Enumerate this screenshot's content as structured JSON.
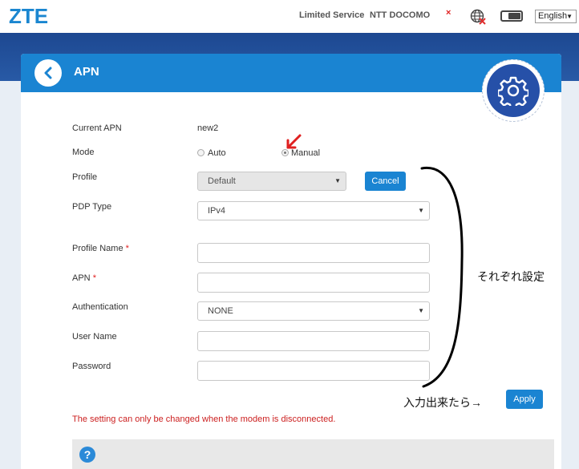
{
  "header": {
    "logo": "ZTE",
    "service_status": "Limited Service",
    "operator": "NTT DOCOMO",
    "signal_mark": "×",
    "language": "English"
  },
  "panel": {
    "title": "APN"
  },
  "form": {
    "current_apn_label": "Current APN",
    "current_apn_value": "new2",
    "mode_label": "Mode",
    "mode_options": [
      "Auto",
      "Manual"
    ],
    "mode_selected": "Manual",
    "profile_label": "Profile",
    "profile_value": "Default",
    "cancel_label": "Cancel",
    "pdp_type_label": "PDP Type",
    "pdp_type_value": "IPv4",
    "profile_name_label": "Profile Name",
    "apn_label": "APN",
    "required_mark": "*",
    "authentication_label": "Authentication",
    "authentication_value": "NONE",
    "user_name_label": "User Name",
    "password_label": "Password",
    "apply_label": "Apply",
    "notice": "The setting can only be changed when the modem is disconnected."
  },
  "help": {
    "icon": "?"
  },
  "annotations": {
    "each_setting": "それぞれ設定",
    "after_input": "入力出来たら→"
  },
  "colors": {
    "accent": "#1a84d2",
    "header_band": "#1e4a92",
    "warning": "#cc2020",
    "annotation_arrow": "#e02020"
  }
}
